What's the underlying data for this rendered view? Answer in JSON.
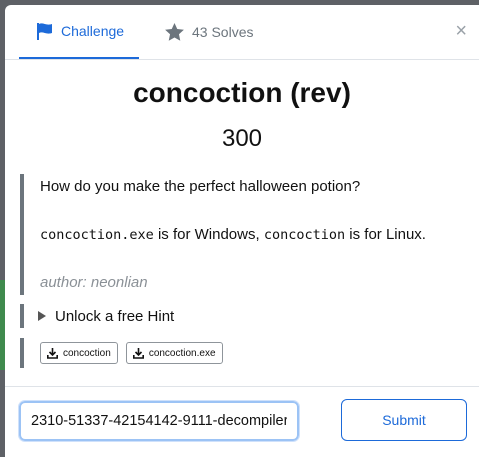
{
  "tabs": {
    "challenge_label": "Challenge",
    "solves_label": "43 Solves",
    "close_label": "×"
  },
  "challenge": {
    "name": "concoction (rev)",
    "points": "300",
    "description_line1": "How do you make the perfect halloween potion?",
    "desc_file1": "concoction.exe",
    "desc_mid": " is for Windows, ",
    "desc_file2": "concoction",
    "desc_end": " is for Linux.",
    "author": "author: neonlian",
    "hint_label": "Unlock a free Hint",
    "files": [
      "concoction",
      "concoction.exe"
    ]
  },
  "footer": {
    "flag_value": "2310-51337-42154142-9111-decompiler|",
    "submit_label": "Submit"
  },
  "colors": {
    "accent": "#1d6ad9",
    "muted": "#6c757d"
  },
  "icons": {
    "challenge_tab": "flag-icon",
    "solves_tab": "star-icon",
    "file": "download-icon"
  }
}
